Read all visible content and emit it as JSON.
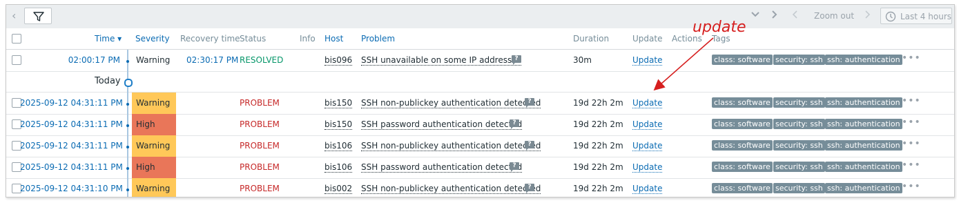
{
  "toolbar": {
    "zoom_out": "Zoom out",
    "last_period": "Last 4 hours"
  },
  "header": {
    "time": "Time ▾",
    "severity": "Severity",
    "recovery_time": "Recovery time",
    "status": "Status",
    "info": "Info",
    "host": "Host",
    "problem": "Problem",
    "duration": "Duration",
    "update": "Update",
    "actions": "Actions",
    "tags": "Tags"
  },
  "today_label": "Today",
  "annotation": "update",
  "colors": {
    "warning": "#ffc859",
    "high": "#e97659",
    "accent": "#0a6bb3",
    "annotation": "#d61f1f"
  },
  "rows": [
    {
      "time": "02:00:17 PM",
      "severity": "Warning",
      "severity_color": "none",
      "recovery_time": "02:30:17 PM",
      "status": "RESOLVED",
      "host": "bis096",
      "problem": "SSH unavailable on some IP addresses",
      "duration": "30m",
      "update": "Update",
      "tags": [
        "class: software",
        "security: ssh",
        "ssh: authentication"
      ]
    },
    {
      "time": "2025-09-12 04:31:11 PM",
      "severity": "Warning",
      "severity_color": "warning",
      "recovery_time": "",
      "status": "PROBLEM",
      "host": "bis150",
      "problem": "SSH non-publickey authentication detected",
      "duration": "19d 22h 2m",
      "update": "Update",
      "tags": [
        "class: software",
        "security: ssh",
        "ssh: authentication"
      ]
    },
    {
      "time": "2025-09-12 04:31:11 PM",
      "severity": "High",
      "severity_color": "high",
      "recovery_time": "",
      "status": "PROBLEM",
      "host": "bis150",
      "problem": "SSH password authentication detected",
      "duration": "19d 22h 2m",
      "update": "Update",
      "tags": [
        "class: software",
        "security: ssh",
        "ssh: authentication"
      ]
    },
    {
      "time": "2025-09-12 04:31:11 PM",
      "severity": "Warning",
      "severity_color": "warning",
      "recovery_time": "",
      "status": "PROBLEM",
      "host": "bis106",
      "problem": "SSH non-publickey authentication detected",
      "duration": "19d 22h 2m",
      "update": "Update",
      "tags": [
        "class: software",
        "security: ssh",
        "ssh: authentication"
      ]
    },
    {
      "time": "2025-09-12 04:31:11 PM",
      "severity": "High",
      "severity_color": "high",
      "recovery_time": "",
      "status": "PROBLEM",
      "host": "bis106",
      "problem": "SSH password authentication detected",
      "duration": "19d 22h 2m",
      "update": "Update",
      "tags": [
        "class: software",
        "security: ssh",
        "ssh: authentication"
      ]
    },
    {
      "time": "2025-09-12 04:31:10 PM",
      "severity": "Warning",
      "severity_color": "warning",
      "recovery_time": "",
      "status": "PROBLEM",
      "host": "bis002",
      "problem": "SSH non-publickey authentication detected",
      "duration": "19d 22h 2m",
      "update": "Update",
      "tags": [
        "class: software",
        "security: ssh",
        "ssh: authentication"
      ]
    }
  ]
}
